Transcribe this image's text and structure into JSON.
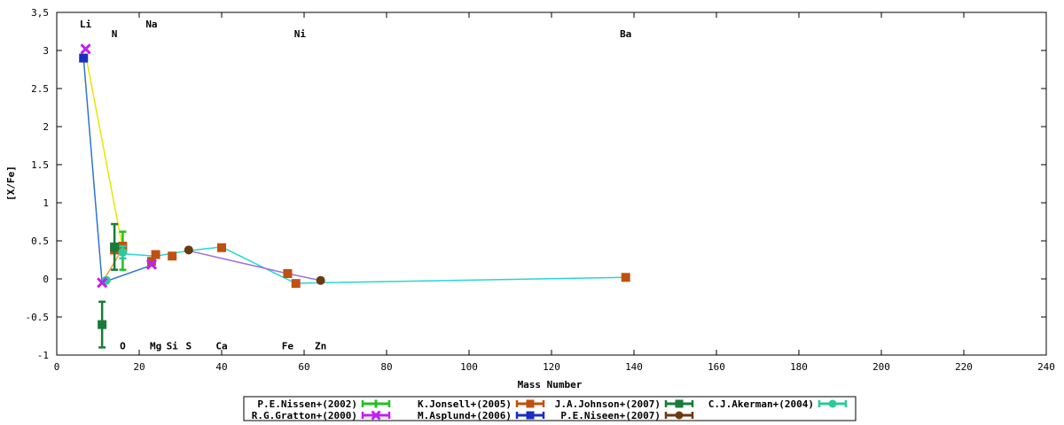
{
  "chart_data": {
    "type": "scatter",
    "xlabel": "Mass Number",
    "ylabel": "[X/Fe]",
    "xlim": [
      0,
      240
    ],
    "ylim": [
      -1,
      3.5
    ],
    "x_ticks": [
      0,
      20,
      40,
      60,
      80,
      100,
      120,
      140,
      160,
      180,
      200,
      220,
      240
    ],
    "y_ticks": [
      "-1",
      "-0.5",
      "0",
      "0.5",
      "1",
      "1.5",
      "2",
      "2.5",
      "3",
      "3,5"
    ],
    "grid": false,
    "legend_position": "bottom-center",
    "element_labels_top": [
      {
        "text": "Li",
        "x": 7,
        "y": 3.35
      },
      {
        "text": "N",
        "x": 14,
        "y": 3.22
      },
      {
        "text": "Na",
        "x": 23,
        "y": 3.35
      },
      {
        "text": "Ni",
        "x": 59,
        "y": 3.22
      },
      {
        "text": "Ba",
        "x": 138,
        "y": 3.22
      }
    ],
    "element_labels_bottom": [
      {
        "text": "O",
        "x": 16,
        "y": -0.88
      },
      {
        "text": "Mg",
        "x": 24,
        "y": -0.88
      },
      {
        "text": "Si",
        "x": 28,
        "y": -0.88
      },
      {
        "text": "S",
        "x": 32,
        "y": -0.88
      },
      {
        "text": "Ca",
        "x": 40,
        "y": -0.88
      },
      {
        "text": "Fe",
        "x": 56,
        "y": -0.88
      },
      {
        "text": "Zn",
        "x": 64,
        "y": -0.88
      }
    ],
    "trend_lines": [
      {
        "color": "#e6e600",
        "points": [
          [
            7,
            2.95
          ],
          [
            16,
            0.4
          ]
        ]
      },
      {
        "color": "#f0a030",
        "points": [
          [
            11,
            -0.05
          ],
          [
            16,
            0.4
          ]
        ]
      },
      {
        "color": "#2f74d0",
        "points": [
          [
            6.5,
            2.9
          ],
          [
            11,
            -0.05
          ],
          [
            23,
            0.18
          ]
        ]
      },
      {
        "color": "#29d4d4",
        "points": [
          [
            14,
            0.42
          ],
          [
            16,
            0.33
          ],
          [
            24,
            0.3
          ],
          [
            32,
            0.37
          ],
          [
            40,
            0.42
          ],
          [
            58,
            -0.06
          ],
          [
            64,
            -0.05
          ],
          [
            138,
            0.02
          ]
        ]
      },
      {
        "color": "#a070e0",
        "points": [
          [
            32,
            0.37
          ],
          [
            56,
            0.07
          ],
          [
            64,
            -0.02
          ]
        ]
      }
    ],
    "series": [
      {
        "name": "P.E.Nissen+(2002)",
        "color": "#22c022",
        "marker": "plus",
        "points": [
          [
            16,
            0.37,
            0.25
          ]
        ]
      },
      {
        "name": "K.Jonsell+(2005)",
        "color": "#c05010",
        "marker": "square",
        "points": [
          [
            14,
            0.38,
            0
          ],
          [
            16,
            0.43,
            0
          ],
          [
            23,
            0.23,
            0
          ],
          [
            24,
            0.32,
            0
          ],
          [
            28,
            0.3,
            0
          ],
          [
            40,
            0.41,
            0
          ],
          [
            56,
            0.07,
            0
          ],
          [
            58,
            -0.06,
            0
          ],
          [
            138,
            0.02,
            0
          ]
        ]
      },
      {
        "name": "J.A.Johnson+(2007)",
        "color": "#1a7a3a",
        "marker": "square",
        "points": [
          [
            11,
            -0.6,
            0.3
          ],
          [
            14,
            0.42,
            0.3
          ]
        ]
      },
      {
        "name": "C.J.Akerman+(2004)",
        "color": "#2cc99a",
        "marker": "circle",
        "points": [
          [
            12,
            -0.02,
            0
          ],
          [
            16,
            0.35,
            0.08
          ]
        ]
      },
      {
        "name": "R.G.Gratton+(2000)",
        "color": "#c020f0",
        "marker": "x",
        "points": [
          [
            7,
            3.02,
            0
          ],
          [
            11,
            -0.05,
            0
          ],
          [
            23,
            0.19,
            0
          ]
        ]
      },
      {
        "name": "M.Asplund+(2006)",
        "color": "#1a2fc0",
        "marker": "square",
        "points": [
          [
            6.5,
            2.9,
            0
          ]
        ]
      },
      {
        "name": "P.E.Niseen+(2007)",
        "color": "#6a3a10",
        "marker": "circle",
        "points": [
          [
            32,
            0.38,
            0
          ],
          [
            64,
            -0.02,
            0
          ]
        ]
      }
    ],
    "legend_rows": [
      [
        "P.E.Nissen+(2002)",
        "K.Jonsell+(2005)",
        "J.A.Johnson+(2007)",
        "C.J.Akerman+(2004)"
      ],
      [
        "R.G.Gratton+(2000)",
        "M.Asplund+(2006)",
        "P.E.Niseen+(2007)"
      ]
    ]
  }
}
